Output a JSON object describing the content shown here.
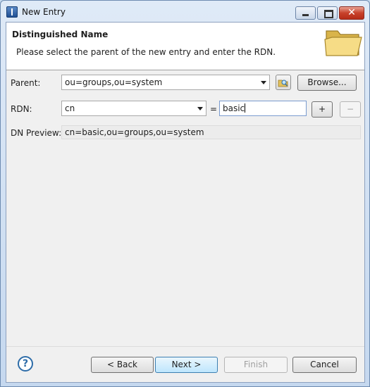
{
  "window": {
    "title": "New Entry",
    "close_glyph": "✕"
  },
  "header": {
    "title": "Distinguished Name",
    "description": "Please select the parent of the new entry and enter the RDN.",
    "icon": "folder-icon"
  },
  "form": {
    "parent_label": "Parent:",
    "parent_value": "ou=groups,ou=system",
    "browse_label": "Browse...",
    "rdn_label": "RDN:",
    "rdn_type": "cn",
    "equals": "=",
    "rdn_value": "basic",
    "add_label": "+",
    "remove_label": "−",
    "dn_preview_label": "DN Preview:",
    "dn_preview_value": "cn=basic,ou=groups,ou=system"
  },
  "footer": {
    "help_glyph": "?",
    "back_label": "< Back",
    "next_label": "Next >",
    "finish_label": "Finish",
    "cancel_label": "Cancel"
  },
  "colors": {
    "accent": "#3c7fb1",
    "window_frame": "#c5d8ef",
    "client_bg": "#f0f0f0"
  }
}
